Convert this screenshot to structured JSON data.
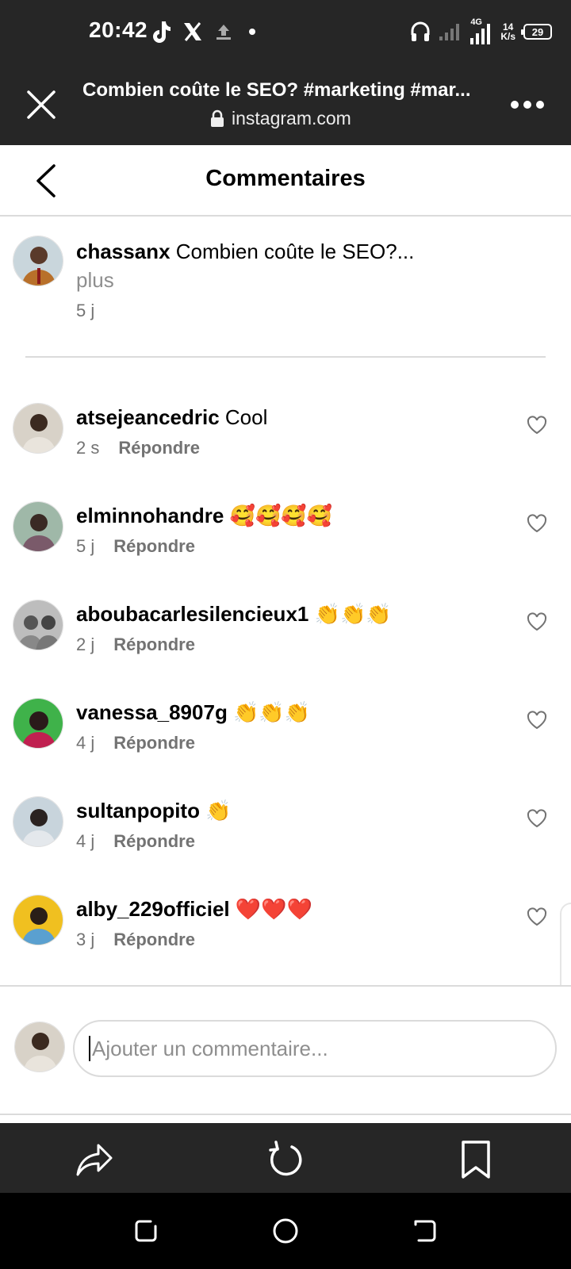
{
  "status_bar": {
    "time": "20:42",
    "network_type": "4G",
    "speed_value": "14",
    "speed_unit": "K/s",
    "battery": "29"
  },
  "browser": {
    "title": "Combien coûte le SEO? #marketing #mar...",
    "url": "instagram.com"
  },
  "header": {
    "title": "Commentaires"
  },
  "caption": {
    "username": "chassanx",
    "text": "Combien coûte le SEO?...",
    "more_label": "plus",
    "time": "5 j"
  },
  "comments": [
    {
      "username": "atsejeancedric",
      "text": "Cool",
      "time": "2 s",
      "reply_label": "Répondre"
    },
    {
      "username": "elminnohandre",
      "text": "🥰🥰🥰🥰",
      "time": "5 j",
      "reply_label": "Répondre"
    },
    {
      "username": "aboubacarlesilencieux1",
      "text": "👏👏👏",
      "time": "2 j",
      "reply_label": "Répondre"
    },
    {
      "username": "vanessa_8907g",
      "text": "👏👏👏",
      "time": "4 j",
      "reply_label": "Répondre"
    },
    {
      "username": "sultanpopito",
      "text": "👏",
      "time": "4 j",
      "reply_label": "Répondre"
    },
    {
      "username": "alby_229officiel",
      "text": "❤️❤️❤️",
      "time": "3 j",
      "reply_label": "Répondre"
    }
  ],
  "composer": {
    "placeholder": "Ajouter un commentaire..."
  },
  "icons": {
    "close": "close-icon",
    "more": "more-icon",
    "back": "chevron-left-icon",
    "heart": "heart-icon",
    "share": "share-icon",
    "reload": "reload-icon",
    "bookmark": "bookmark-icon"
  },
  "colors": {
    "dark_bar": "#262626",
    "secondary_text": "#737373",
    "divider": "#dbdbdb"
  }
}
